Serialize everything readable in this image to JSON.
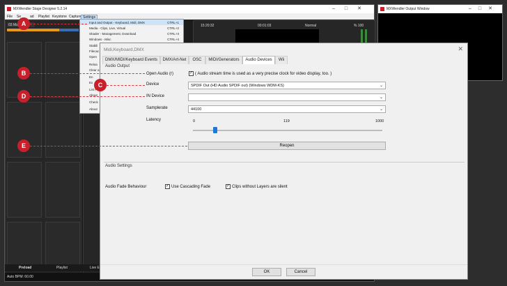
{
  "app": {
    "title": "MXWendler Stage Designer 5.2.14",
    "menu": [
      "File",
      "Se",
      "ad",
      "Playlist",
      "Keystone",
      "Capture",
      "Settings"
    ],
    "panel_label": "03 Ma",
    "time_left": "15:20:32",
    "time_mid": "00:01:03",
    "blend_mode": "Normal",
    "percent": "% 100",
    "bottom_tabs": [
      "Preload",
      "Playlist",
      "Live En"
    ],
    "auto_bpm": "Auto BPM: 60.00",
    "menu_partials": [
      "Stabili",
      "Filecac",
      "Open",
      "Reloa",
      "Clear a",
      "En",
      "Ex",
      "List Pe",
      "About",
      "Check",
      "About"
    ]
  },
  "dropdown": {
    "items": [
      {
        "label": "Input and Output - Keyboard, Midi, DMX",
        "shortcut": "CTRL+1"
      },
      {
        "label": "Media - Clips, Live, Virtual",
        "shortcut": "CTRL+2"
      },
      {
        "label": "Shader - Management, Download",
        "shortcut": "CTRL+3"
      },
      {
        "label": "Windows - Misc",
        "shortcut": "CTRL+4"
      }
    ]
  },
  "output_window": {
    "title": "MXWendler Output Window"
  },
  "dialog": {
    "title": "Midi,Keyboard,DMX",
    "close": "✕",
    "tabs": [
      "DMX/MIDI/Keyboard Events",
      "DMX/Art-Net",
      "OSC",
      "MIDI/Generators",
      "Audio Devices",
      "Wii"
    ],
    "active_tab": 4,
    "audio_output": {
      "group_label": "Audio Output",
      "open_audio_label": "Open Audio (r)",
      "open_audio_note": "( Audio stream time is used as a very precise clock for video display, too. )",
      "device_label": "Device",
      "device_value": "SPDIF Out (HD Audio SPDIF out)    (Windows WDM-KS)",
      "in_device_label": "IN Device",
      "in_device_value": "",
      "samplerate_label": "Samplerate",
      "samplerate_value": "44100",
      "latency_label": "Latency",
      "latency_min": "0",
      "latency_mid": "119",
      "latency_max": "1000",
      "latency_value": 119,
      "reopen_label": "Reopen"
    },
    "audio_settings": {
      "group_label": "Audio Settings",
      "fade_label": "Audio Fade Behaviour",
      "cascading_label": "Use Cascading Fade",
      "silent_label": "Clips without Layers are silent"
    },
    "ok_label": "OK",
    "cancel_label": "Cancel"
  },
  "annotations": [
    "A",
    "B",
    "C",
    "D",
    "E"
  ],
  "colors": {
    "accent_red": "#c8202a",
    "thumb_blue": "#1e78d4"
  }
}
